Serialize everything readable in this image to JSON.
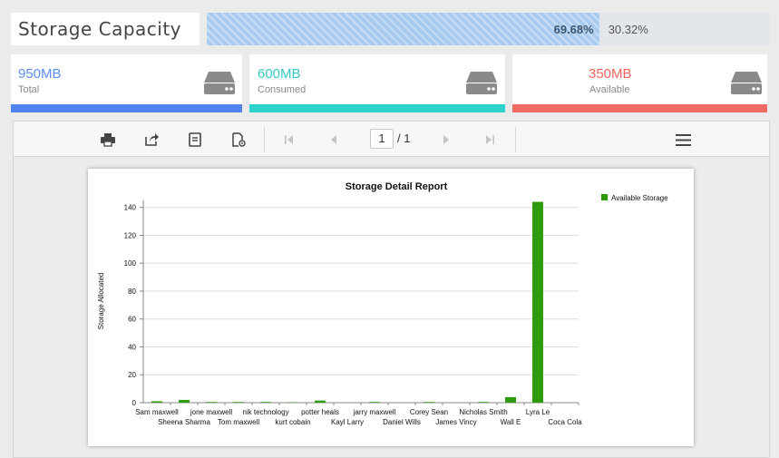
{
  "header": {
    "title": "Storage Capacity",
    "used_percent_label": "69.68%",
    "free_percent_label": "30.32%",
    "used_fraction": 0.6968
  },
  "cards": [
    {
      "value": "950MB",
      "label": "Total",
      "color": "#5b8ef0",
      "bar_color": "#4f83f0",
      "icon": "hard-drive-icon"
    },
    {
      "value": "600MB",
      "label": "Consumed",
      "color": "#35c9c3",
      "bar_color": "#2fd3cd",
      "icon": "hard-drive-icon"
    },
    {
      "value": "350MB",
      "label": "Available",
      "color": "#f0625c",
      "bar_color": "#f06a63",
      "icon": "hard-drive-icon"
    }
  ],
  "toolbar": {
    "current_page": "1",
    "total_pages": "/ 1",
    "icons": [
      "print-icon",
      "export-icon",
      "document-icon",
      "page-setup-icon",
      "first-page-icon",
      "previous-page-icon",
      "next-page-icon",
      "last-page-icon",
      "menu-icon"
    ]
  },
  "chart_data": {
    "type": "bar",
    "title": "Storage Detail Report",
    "ylabel": "Storage Allocated",
    "xlabel": "",
    "ylim": [
      0,
      145
    ],
    "yticks": [
      0,
      20,
      40,
      60,
      80,
      100,
      120,
      140
    ],
    "grid": true,
    "legend_position": "top-right",
    "categories": [
      "Sam maxwell",
      "Sheena Sharma",
      "jone maxwell",
      "Tom maxwell",
      "nik technology",
      "kurt cobain",
      "potter heals",
      "Kayl Larry",
      "jarry maxwell",
      "Daniel Wills",
      "Corey Sean",
      "James Vincy",
      "Nicholas Smith",
      "Wall E",
      "Lyra Le",
      "Coca Cola"
    ],
    "series": [
      {
        "name": "Available Storage",
        "color": "#2e9a0c",
        "values": [
          1,
          2,
          0.5,
          0.5,
          0.5,
          0.3,
          1.5,
          0,
          0.5,
          0,
          0.5,
          0,
          0.5,
          4,
          144,
          0
        ]
      }
    ]
  }
}
